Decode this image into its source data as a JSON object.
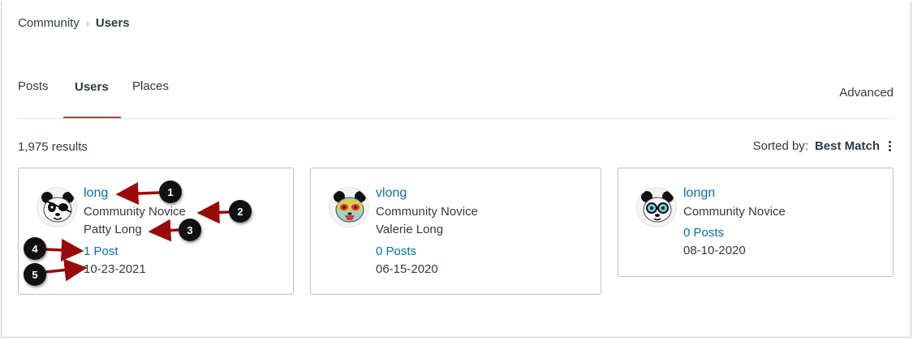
{
  "breadcrumb": {
    "parent": "Community",
    "separator": "›",
    "current": "Users"
  },
  "tabs": [
    {
      "label": "Posts"
    },
    {
      "label": "Users",
      "active": true
    },
    {
      "label": "Places"
    }
  ],
  "advanced_label": "Advanced",
  "results_text": "1,975 results",
  "sort": {
    "label": "Sorted by:",
    "value": "Best Match"
  },
  "users": [
    {
      "username": "long",
      "rank": "Community Novice",
      "full_name": "Patty Long",
      "posts": "1 Post",
      "date": "10-23-2021",
      "avatar_icon": "panda-eyepatch-icon"
    },
    {
      "username": "vlong",
      "rank": "Community Novice",
      "full_name": "Valerie Long",
      "posts": "0 Posts",
      "date": "06-15-2020",
      "avatar_icon": "panda-luchador-mask-icon"
    },
    {
      "username": "longn",
      "rank": "Community Novice",
      "full_name": "",
      "posts": "0 Posts",
      "date": "08-10-2020",
      "avatar_icon": "panda-glasses-icon"
    }
  ],
  "callouts": [
    "1",
    "2",
    "3",
    "4",
    "5"
  ],
  "colors": {
    "link": "#0770a3",
    "text": "#2d3b45",
    "active_tab_underline": "#d0343b",
    "callout_arrow": "#9a0a0a"
  }
}
